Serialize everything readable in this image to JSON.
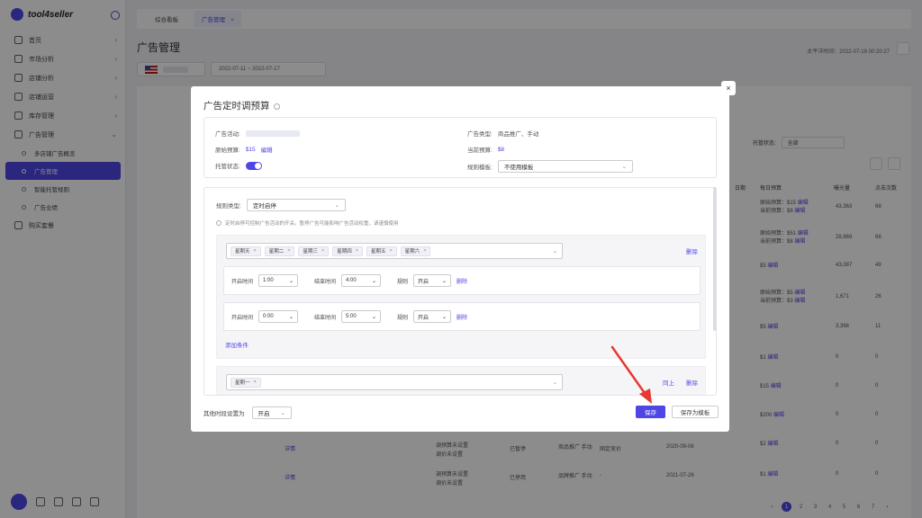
{
  "app": {
    "name": "tool4seller"
  },
  "sidebar": {
    "items": [
      {
        "label": "首页",
        "icon": "home-icon"
      },
      {
        "label": "市场分析",
        "icon": "market-icon"
      },
      {
        "label": "店铺分析",
        "icon": "shop-analysis-icon"
      },
      {
        "label": "店铺运营",
        "icon": "shop-ops-icon"
      },
      {
        "label": "库存管理",
        "icon": "inventory-icon"
      },
      {
        "label": "广告管理",
        "icon": "ads-icon"
      }
    ],
    "sub_items": [
      {
        "label": "多店铺广告概览",
        "active": false
      },
      {
        "label": "广告管理",
        "active": true
      },
      {
        "label": "智能托管规则",
        "active": false
      },
      {
        "label": "广告业绩",
        "active": false
      }
    ],
    "extra": {
      "label": "购买套餐",
      "icon": "cart-icon"
    }
  },
  "tabs": [
    {
      "label": "综合看板",
      "active": false
    },
    {
      "label": "广告管理",
      "active": true
    }
  ],
  "page": {
    "title": "广告管理",
    "beijing_time": "太平洋时间：2022-07-19 00:20:27",
    "date_range": "2022-07-11 ~ 2022-07-17",
    "status_filter_label": "托管状态:",
    "status_filter_value": "全部"
  },
  "background_table": {
    "headers": [
      "日期",
      "每日预算",
      "曝光量",
      "点击次数"
    ],
    "rows": [
      {
        "budget": [
          "原始预算：$15 ",
          "当前预算：$8 "
        ],
        "impr": "43,363",
        "clicks": "68"
      },
      {
        "budget": [
          "原始预算：$51 ",
          "当前预算：$8 "
        ],
        "impr": "28,869",
        "clicks": "68"
      },
      {
        "budget": [
          "$5 "
        ],
        "impr": "43,087",
        "clicks": "49"
      },
      {
        "budget": [
          "原始预算：$5 ",
          "当前预算：$3 "
        ],
        "impr": "1,671",
        "clicks": "26"
      },
      {
        "budget": [
          "$5 "
        ],
        "impr": "3,366",
        "clicks": "11"
      },
      {
        "budget": [
          "$1 "
        ],
        "impr": "0",
        "clicks": "0"
      },
      {
        "budget": [
          "$15 "
        ],
        "impr": "0",
        "clicks": "0"
      },
      {
        "budget": [
          "$200 "
        ],
        "impr": "0",
        "clicks": "0"
      },
      {
        "budget": [
          "$2 "
        ],
        "impr": "0",
        "clicks": "0"
      },
      {
        "budget": [
          "$1 "
        ],
        "impr": "0",
        "clicks": "0"
      }
    ],
    "edit": "编辑",
    "bottom_rows": [
      {
        "detail": "详情",
        "l1": "调预算未设置",
        "l2": "调价未设置",
        "status": "已暂停",
        "type": "商品推广 手动",
        "bid": "固定竞价",
        "date": "2020-09-06"
      },
      {
        "detail": "详情",
        "l1": "调预算未设置",
        "l2": "调价未设置",
        "status": "已停用",
        "type": "品牌推广 手动",
        "bid": "-",
        "date": "2021-07-26"
      }
    ],
    "pages": [
      "1",
      "2",
      "3",
      "4",
      "5",
      "6",
      "7"
    ],
    "pager_prev": "‹",
    "pager_next": "›"
  },
  "modal": {
    "title": "广告定时调预算",
    "info": {
      "campaign_label": "广告活动:",
      "type_label": "广告类型:",
      "type_value": "商品推广、手动",
      "orig_budget_label": "原始预算:",
      "orig_budget_value": "$15",
      "edit": "编辑",
      "cur_budget_label": "当前预算:",
      "cur_budget_value": "$8",
      "managed_label": "托管状态:",
      "template_label": "规则模板:",
      "template_value": "不使用模板"
    },
    "rules": {
      "type_label": "规则类型:",
      "type_value": "定时启停",
      "hint": "定时启停可控制广告活动的开关。暂停广告可能影响广告活动权重，请谨慎使用",
      "group1_days": [
        "星期天",
        "星期二",
        "星期三",
        "星期四",
        "星期五",
        "星期六"
      ],
      "delete": "删除",
      "times": [
        {
          "start_label": "开启时间",
          "start": "1:00",
          "end_label": "结束时间",
          "end": "4:00",
          "rule_label": "规则",
          "rule": "开启"
        },
        {
          "start_label": "开启时间",
          "start": "0:00",
          "end_label": "结束时间",
          "end": "5:00",
          "rule_label": "规则",
          "rule": "开启"
        }
      ],
      "add_condition": "添加条件",
      "group2_days": [
        "星期一"
      ],
      "same_as_above": "同上"
    },
    "footer": {
      "other_time_label": "其他时段设置为",
      "other_time_value": "开启",
      "save": "保存",
      "save_template": "保存为模板"
    }
  },
  "colors": {
    "accent": "#4f46e5",
    "arrow": "#e53935"
  }
}
